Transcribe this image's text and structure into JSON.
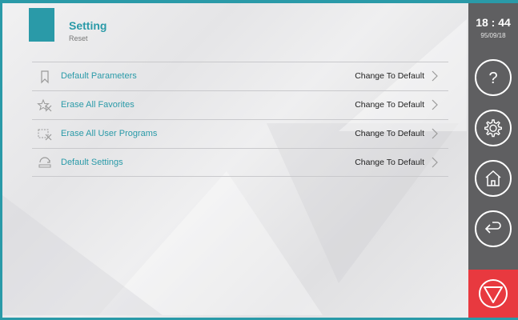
{
  "header": {
    "title": "Setting",
    "subtitle": "Reset"
  },
  "rows": [
    {
      "label": "Default Parameters",
      "action": "Change To Default",
      "icon": "bookmark-icon"
    },
    {
      "label": "Erase All Favorites",
      "action": "Change To Default",
      "icon": "erase-star-icon"
    },
    {
      "label": "Erase All User Programs",
      "action": "Change To Default",
      "icon": "erase-program-icon"
    },
    {
      "label": "Default Settings",
      "action": "Change To Default",
      "icon": "reset-settings-icon"
    }
  ],
  "sidebar": {
    "time": "18 : 44",
    "date": "95/09/18",
    "buttons": [
      "help-icon",
      "gear-icon",
      "home-icon",
      "back-icon",
      "stop-icon"
    ]
  },
  "colors": {
    "accent": "#2a9aa8",
    "sidebar": "#5f5f61",
    "stop": "#e8393f"
  }
}
